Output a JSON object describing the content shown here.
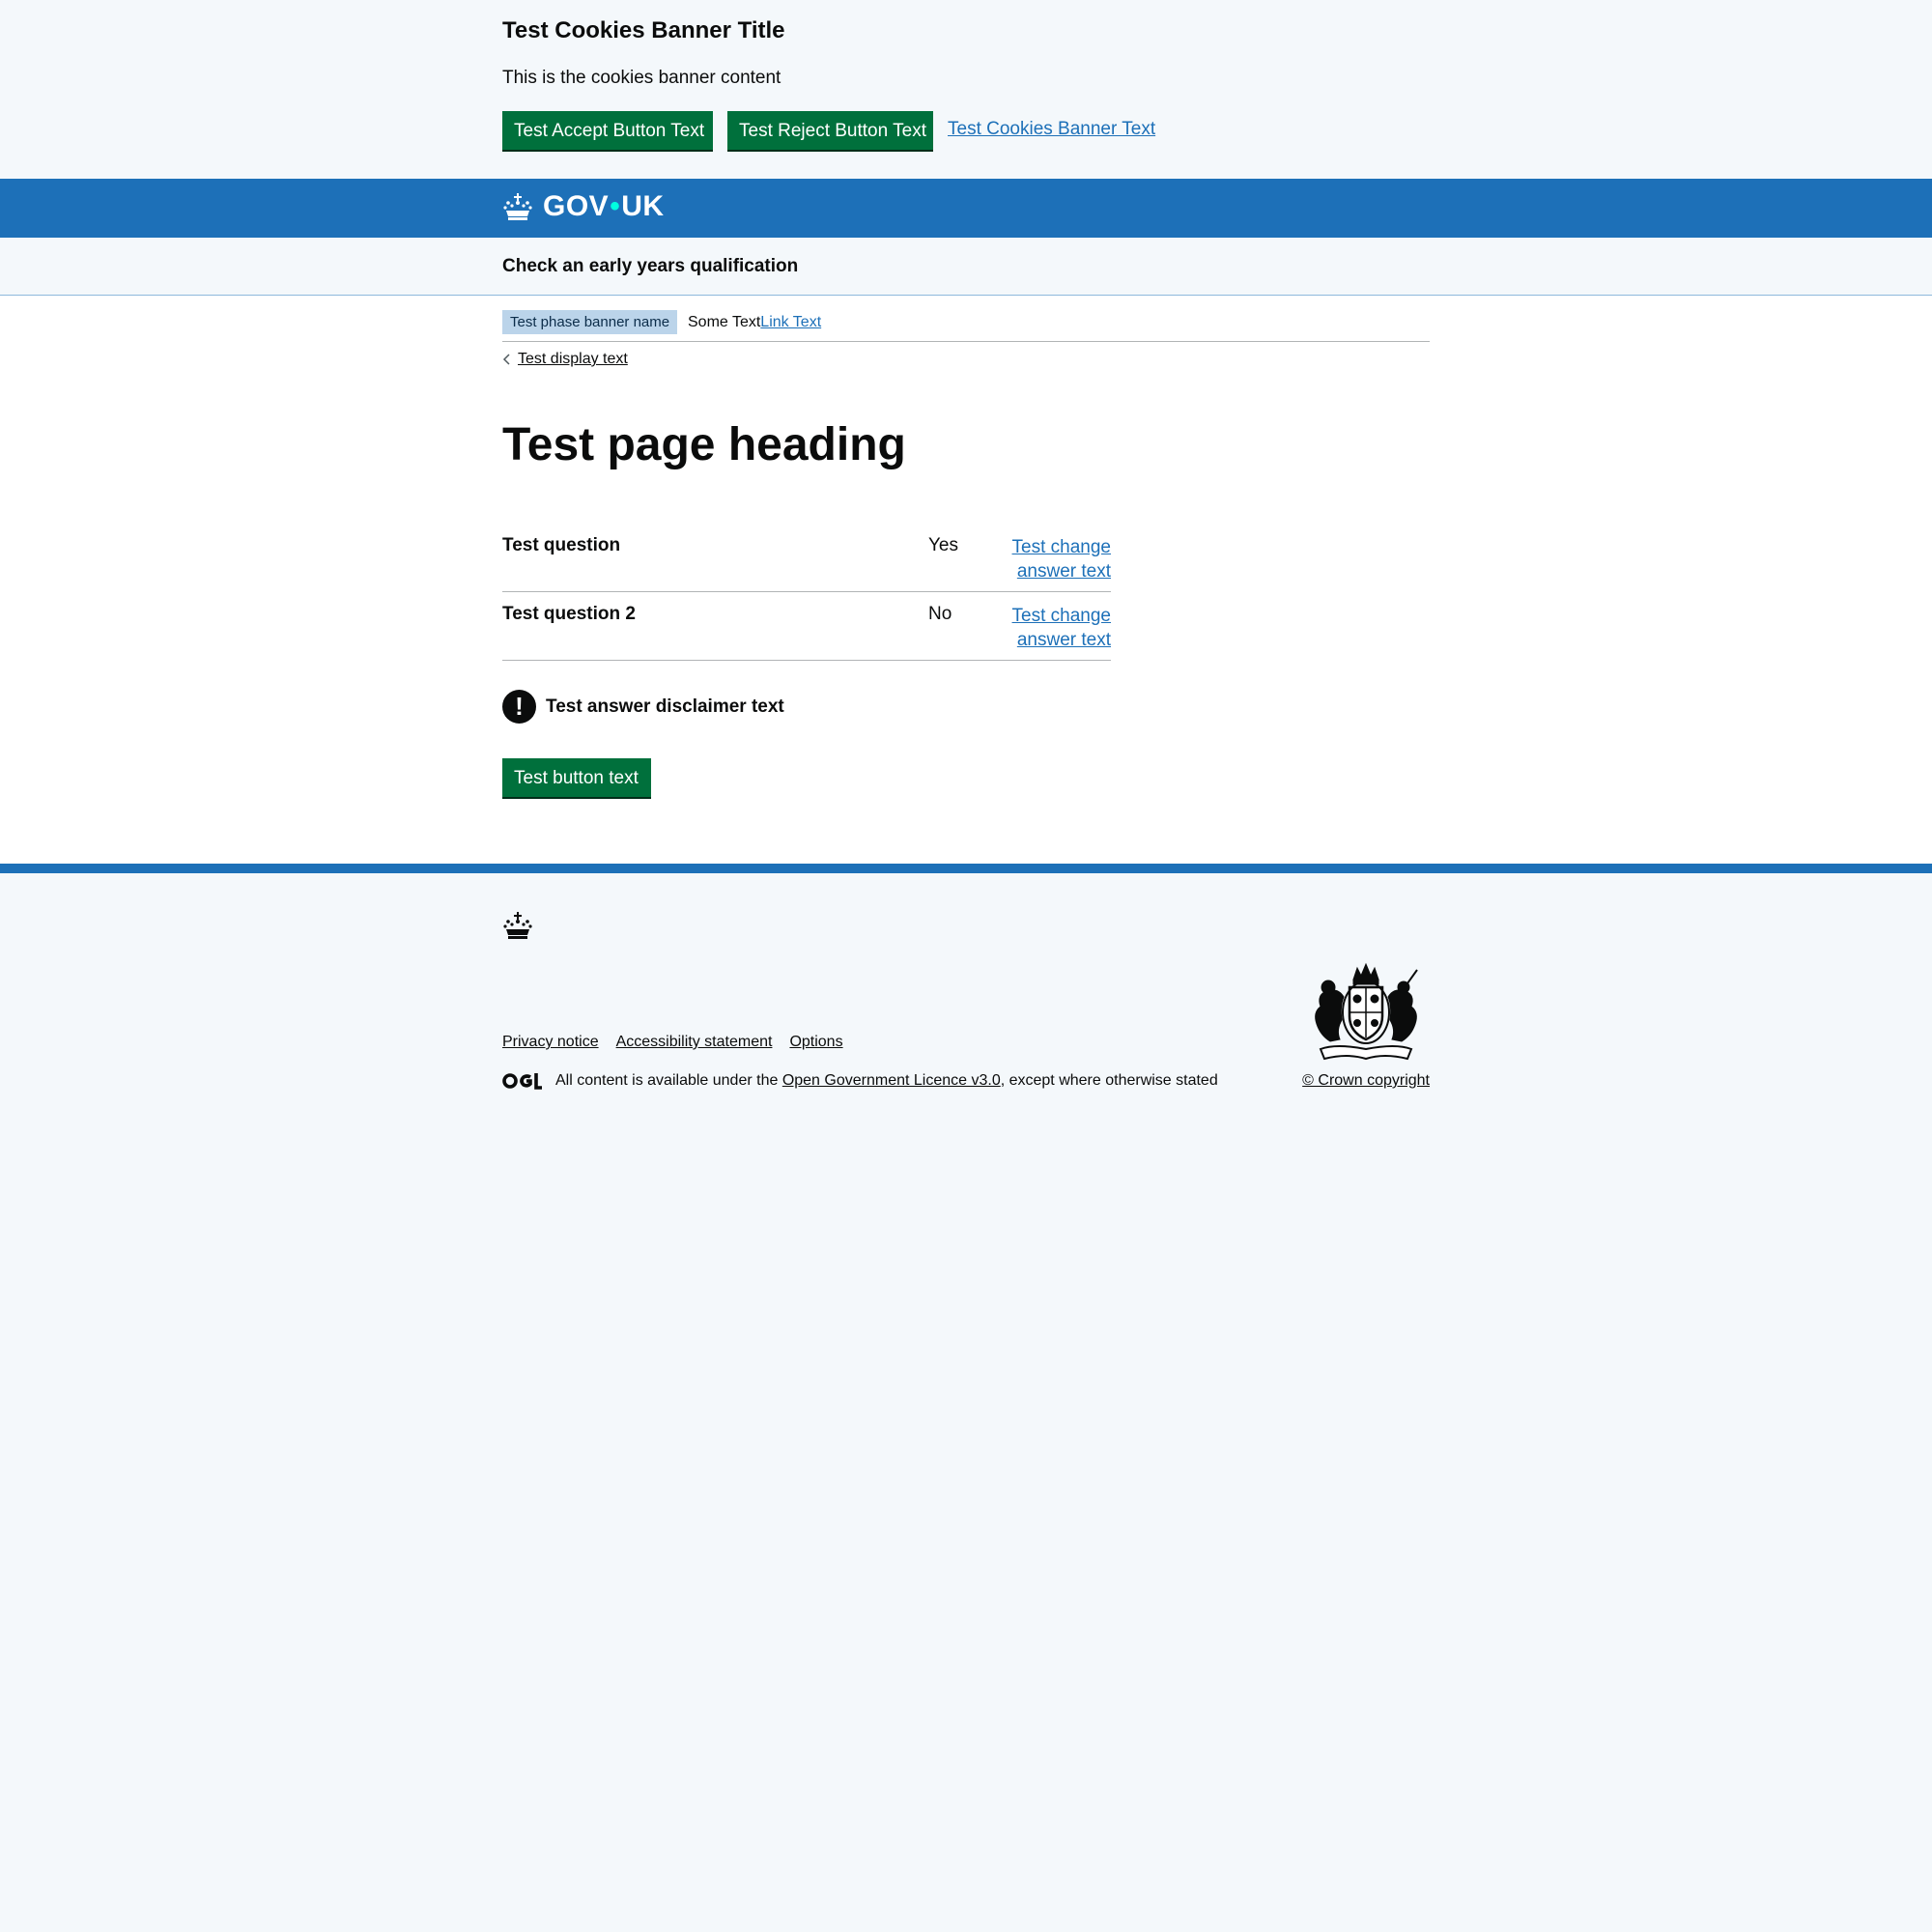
{
  "cookie_banner": {
    "title": "Test Cookies Banner Title",
    "content": "This is the cookies banner content",
    "accept_label": "Test Accept Button Text",
    "reject_label": "Test Reject Button Text",
    "link_text": "Test Cookies Banner Text"
  },
  "header": {
    "logo_gov": "GOV",
    "logo_dot": "•",
    "logo_uk": "UK",
    "crown_icon": "crown-icon"
  },
  "service": {
    "name": "Check an early years qualification"
  },
  "phase_banner": {
    "tag": "Test phase banner name",
    "text": "Some Text",
    "link_text": "Link Text"
  },
  "back_link": {
    "label": "Test display text",
    "icon": "chevron-left-icon"
  },
  "page": {
    "heading": "Test page heading"
  },
  "summary": {
    "rows": [
      {
        "question": "Test question",
        "answer": "Yes",
        "change": "Test change answer text"
      },
      {
        "question": "Test question 2",
        "answer": "No",
        "change": "Test change answer text"
      }
    ]
  },
  "warning": {
    "icon_glyph": "!",
    "text": "Test answer disclaimer text"
  },
  "cta": {
    "label": "Test button text"
  },
  "footer": {
    "links": [
      "Privacy notice",
      "Accessibility statement",
      "Options"
    ],
    "licence_prefix": "All content is available under the ",
    "licence_link": "Open Government Licence v3.0",
    "licence_suffix": ", except where otherwise stated",
    "copyright": "© Crown copyright",
    "ogl_icon": "ogl-logo-icon",
    "crest_icon": "royal-coat-of-arms-icon"
  },
  "colors": {
    "brand_blue": "#1d70b8",
    "button_green": "#00703c",
    "background": "#f4f8fb",
    "link_blue": "#1d70b8",
    "logo_dot": "#00ffe0"
  }
}
